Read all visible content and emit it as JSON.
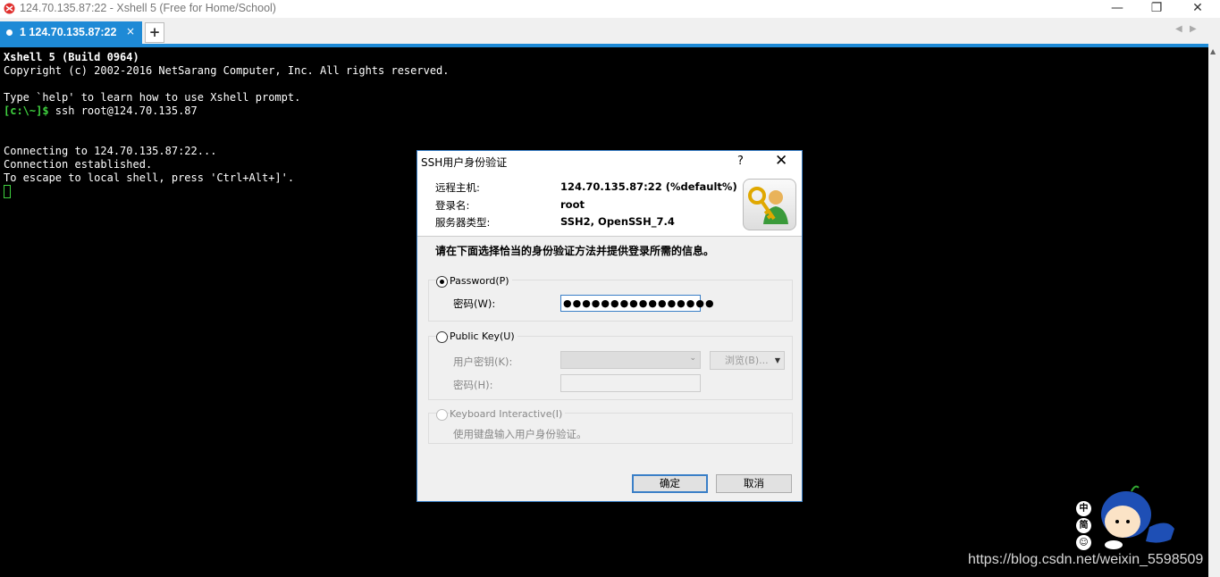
{
  "window": {
    "title": "124.70.135.87:22 - Xshell 5 (Free for Home/School)",
    "minimize": "—",
    "restore": "❐",
    "close": "✕"
  },
  "tabs": [
    {
      "label": "1 124.70.135.87:22",
      "close": "×"
    }
  ],
  "tabbar": {
    "new_tab": "+",
    "prev": "◀",
    "next": "▶"
  },
  "terminal": {
    "lines": [
      {
        "text": "Xshell 5 (Build 0964)"
      },
      {
        "text": "Copyright (c) 2002-2016 NetSarang Computer, Inc. All rights reserved."
      },
      {
        "text": ""
      },
      {
        "text": "Type `help' to learn how to use Xshell prompt."
      },
      {
        "prompt": "[c:\\~]$",
        "text": " ssh root@124.70.135.87"
      },
      {
        "text": ""
      },
      {
        "text": ""
      },
      {
        "text": "Connecting to 124.70.135.87:22..."
      },
      {
        "text": "Connection established."
      },
      {
        "text": "To escape to local shell, press 'Ctrl+Alt+]'."
      }
    ]
  },
  "dialog": {
    "title": "SSH用户身份验证",
    "help": "?",
    "close": "✕",
    "remote_host_label": "远程主机:",
    "remote_host_value": "124.70.135.87:22 (%default%)",
    "login_label": "登录名:",
    "login_value": "root",
    "server_type_label": "服务器类型:",
    "server_type_value": "SSH2, OpenSSH_7.4",
    "instruction": "请在下面选择恰当的身份验证方法并提供登录所需的信息。",
    "password_option": "Password(P)",
    "password_field_label": "密码(W):",
    "password_value": "●●●●●●●●●●●●●●●●",
    "publickey_option": "Public Key(U)",
    "user_key_label": "用户密钥(K):",
    "browse_label": "浏览(B)...",
    "passphrase_label": "密码(H):",
    "keyboard_option": "Keyboard Interactive(I)",
    "keyboard_desc": "使用键盘输入用户身份验证。",
    "ok_label": "确定",
    "cancel_label": "取消",
    "selected_method": "Password"
  },
  "watermark": {
    "text": "https://blog.csdn.net/weixin_5598509",
    "ime": [
      "中",
      "简",
      "☺"
    ]
  },
  "colors": {
    "accent": "#1e8ad6",
    "terminal_bg": "#000000",
    "prompt_green": "#3fd13f"
  }
}
